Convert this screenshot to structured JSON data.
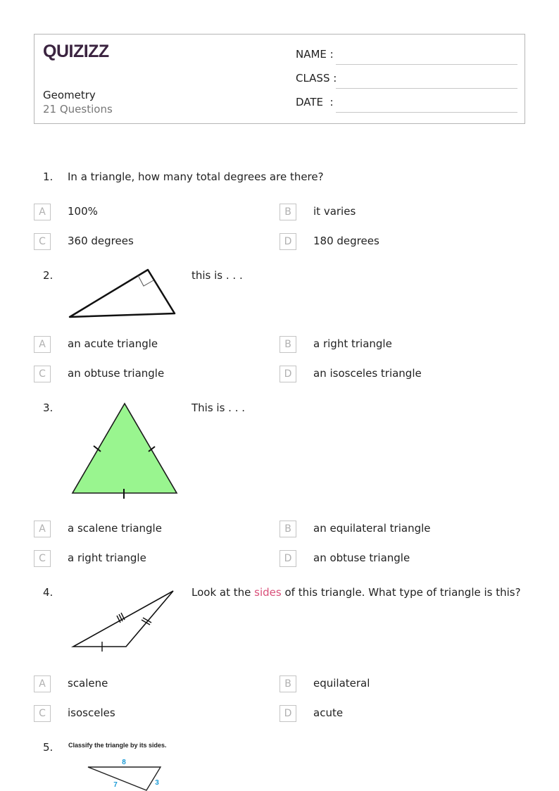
{
  "header": {
    "logo": "QUIZIZZ",
    "title": "Geometry",
    "question_count": "21 Questions",
    "fields": [
      {
        "label": "NAME :"
      },
      {
        "label": "CLASS :"
      },
      {
        "label": "DATE  :"
      }
    ]
  },
  "questions": [
    {
      "number": "1.",
      "text": "In a triangle, how many total degrees are there?",
      "options": [
        {
          "letter": "A",
          "text": "100%"
        },
        {
          "letter": "B",
          "text": "it varies"
        },
        {
          "letter": "C",
          "text": "360 degrees"
        },
        {
          "letter": "D",
          "text": "180 degrees"
        }
      ]
    },
    {
      "number": "2.",
      "text": "this is . . .",
      "figure": "right-triangle",
      "options": [
        {
          "letter": "A",
          "text": "an acute triangle"
        },
        {
          "letter": "B",
          "text": "a right triangle"
        },
        {
          "letter": "C",
          "text": "an obtuse triangle"
        },
        {
          "letter": "D",
          "text": "an isosceles triangle"
        }
      ]
    },
    {
      "number": "3.",
      "text": "This is . . .",
      "figure": "equilateral-triangle",
      "figure_fill": "#99f58f",
      "options": [
        {
          "letter": "A",
          "text": "a scalene triangle"
        },
        {
          "letter": "B",
          "text": "an equilateral triangle"
        },
        {
          "letter": "C",
          "text": "a right triangle"
        },
        {
          "letter": "D",
          "text": "an obtuse triangle"
        }
      ]
    },
    {
      "number": "4.",
      "text_before": "Look at the ",
      "text_highlight": "sides",
      "text_after": " of this triangle. What type of triangle is this?",
      "highlight_color": "#d94f79",
      "figure": "scalene-triangle-tick-marks",
      "options": [
        {
          "letter": "A",
          "text": "scalene"
        },
        {
          "letter": "B",
          "text": "equilateral"
        },
        {
          "letter": "C",
          "text": "isosceles"
        },
        {
          "letter": "D",
          "text": "acute"
        }
      ]
    },
    {
      "number": "5.",
      "figure_caption": "Classify the triangle by its sides.",
      "figure": "triangle-with-side-lengths",
      "side_labels": [
        "8",
        "7",
        "3"
      ],
      "label_color": "#1a9ad6"
    }
  ]
}
